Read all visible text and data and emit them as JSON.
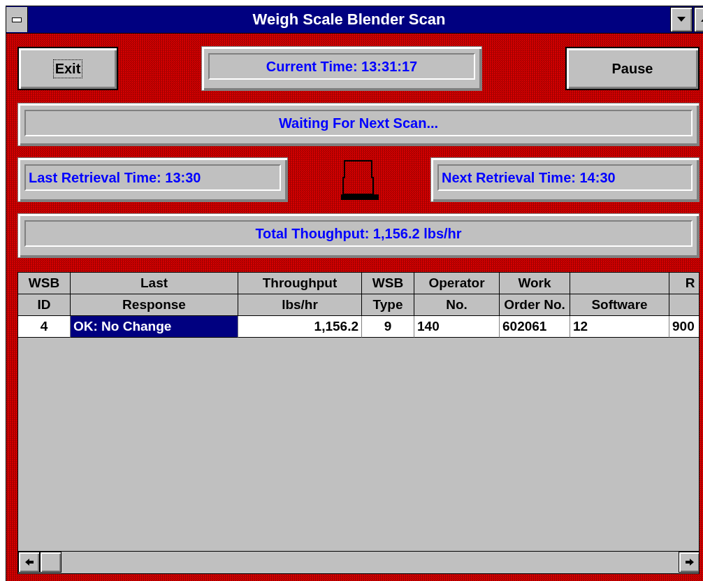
{
  "window": {
    "title": "Weigh Scale Blender Scan"
  },
  "buttons": [
    {
      "label": "Exit",
      "focused": true
    },
    {
      "label": "Pause",
      "focused": false
    }
  ],
  "current_time": "Current Time: 13:31:17",
  "status": "Waiting For Next Scan...",
  "last_retrieval": "Last Retrieval Time: 13:30",
  "next_retrieval": "Next Retrieval Time: 14:30",
  "total": "Total Thoughput:  1,156.2 lbs/hr",
  "table": {
    "columns": [
      {
        "line_1": "WSB",
        "line_2": "ID"
      },
      {
        "line_1": "Last",
        "line_2": "Response"
      },
      {
        "line_1": "Throughput",
        "line_2": "lbs/hr"
      },
      {
        "line_1": "WSB",
        "line_2": "Type"
      },
      {
        "line_1": "Operator",
        "line_2": "No."
      },
      {
        "line_1": "Work",
        "line_2": "Order No."
      },
      {
        "line_2": "Software"
      },
      {
        "line_1": "R"
      }
    ],
    "rows": [
      {
        "cells": [
          {
            "text": "4",
            "selected": false
          },
          {
            "text": "OK: No Change",
            "selected": true
          },
          {
            "text": "1,156.2",
            "selected": false
          },
          {
            "text": "9",
            "selected": false
          },
          {
            "text": "140",
            "selected": false
          },
          {
            "text": "602061",
            "selected": false
          },
          {
            "text": "12",
            "selected": false
          },
          {
            "text": "900",
            "selected": false
          }
        ]
      }
    ]
  }
}
